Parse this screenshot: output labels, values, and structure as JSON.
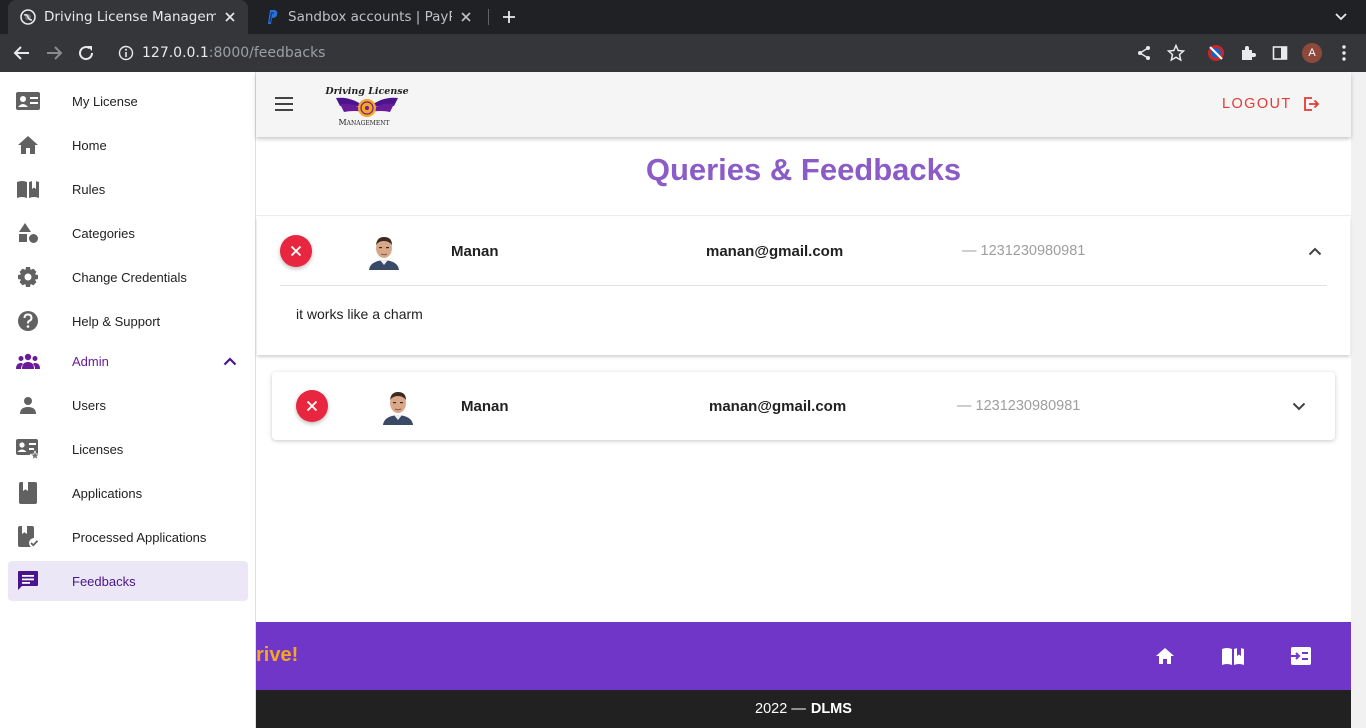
{
  "browser": {
    "tabs": [
      {
        "title": "Driving License Managem",
        "active": true
      },
      {
        "title": "Sandbox accounts | PayPa",
        "active": false
      }
    ],
    "url": {
      "host": "127.0.0.1",
      "path": ":8000/feedbacks"
    },
    "profile_initial": "A"
  },
  "sidebar": {
    "items": [
      {
        "label": "My License",
        "icon": "id-card-icon"
      },
      {
        "label": "Home",
        "icon": "home-icon"
      },
      {
        "label": "Rules",
        "icon": "book-icon"
      },
      {
        "label": "Categories",
        "icon": "shapes-icon"
      },
      {
        "label": "Change Credentials",
        "icon": "gear-icon"
      },
      {
        "label": "Help & Support",
        "icon": "help-icon"
      },
      {
        "label": "Admin",
        "icon": "group-icon",
        "expanded": true
      },
      {
        "label": "Users",
        "icon": "person-icon"
      },
      {
        "label": "Licenses",
        "icon": "license-icon"
      },
      {
        "label": "Applications",
        "icon": "bookmark-book-icon"
      },
      {
        "label": "Processed Applications",
        "icon": "processed-icon"
      },
      {
        "label": "Feedbacks",
        "icon": "feedback-icon",
        "active": true
      }
    ]
  },
  "appbar": {
    "logo": {
      "line1": "Driving License",
      "line2": "Management"
    },
    "logout_label": "LOGOUT"
  },
  "main": {
    "title": "Queries & Feedbacks",
    "feedbacks": [
      {
        "name": "Manan",
        "email": "manan@gmail.com",
        "phone": "— 1231230980981",
        "message": "it works like a charm",
        "expanded": true
      },
      {
        "name": "Manan",
        "email": "manan@gmail.com",
        "phone": "— 1231230980981",
        "expanded": false
      }
    ]
  },
  "footer": {
    "slogan": "rive!",
    "copyright": "2022 —",
    "brand": "DLMS"
  },
  "colors": {
    "primary": "#7036c8",
    "title": "#8b5cc7",
    "danger": "#e8263f",
    "accent": "#f5a623",
    "logout": "#e53935"
  }
}
